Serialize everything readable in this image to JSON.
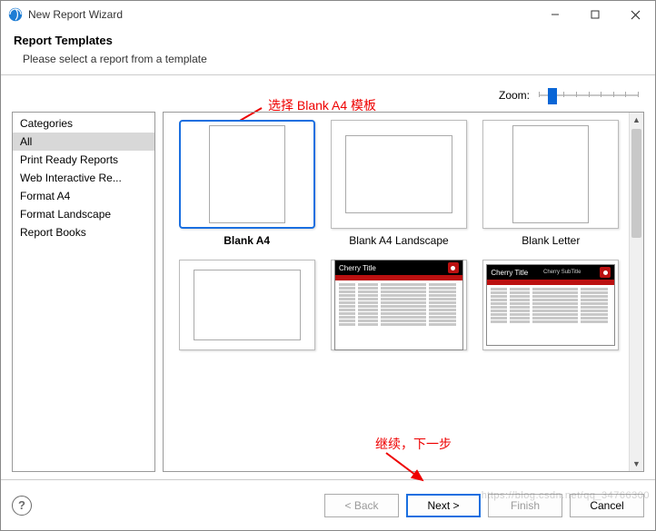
{
  "title": "New Report Wizard",
  "header": {
    "heading": "Report Templates",
    "sub": "Please select a report from a template"
  },
  "annotations": {
    "a1": "选择 Blank A4 模板",
    "a2": "继续，下一步"
  },
  "zoom": {
    "label": "Zoom:"
  },
  "categories": {
    "header": "Categories",
    "items": [
      "All",
      "Print Ready Reports",
      "Web Interactive Re...",
      "Format A4",
      "Format Landscape",
      "Report Books"
    ],
    "selected": 0
  },
  "templates": [
    {
      "label": "Blank A4",
      "kind": "portrait",
      "selected": true
    },
    {
      "label": "Blank A4 Landscape",
      "kind": "landscape",
      "selected": false
    },
    {
      "label": "Blank Letter",
      "kind": "portrait",
      "selected": false
    },
    {
      "label": "",
      "kind": "landscape",
      "selected": false
    },
    {
      "label": "",
      "kind": "cherry",
      "cherry_title": "Cherry Title",
      "selected": false
    },
    {
      "label": "",
      "kind": "cherry-land",
      "cherry_title": "Cherry Title",
      "selected": false
    }
  ],
  "buttons": {
    "back": "< Back",
    "next": "Next >",
    "finish": "Finish",
    "cancel": "Cancel"
  },
  "watermark": "https://blog.csdn.net/qq_34766300"
}
